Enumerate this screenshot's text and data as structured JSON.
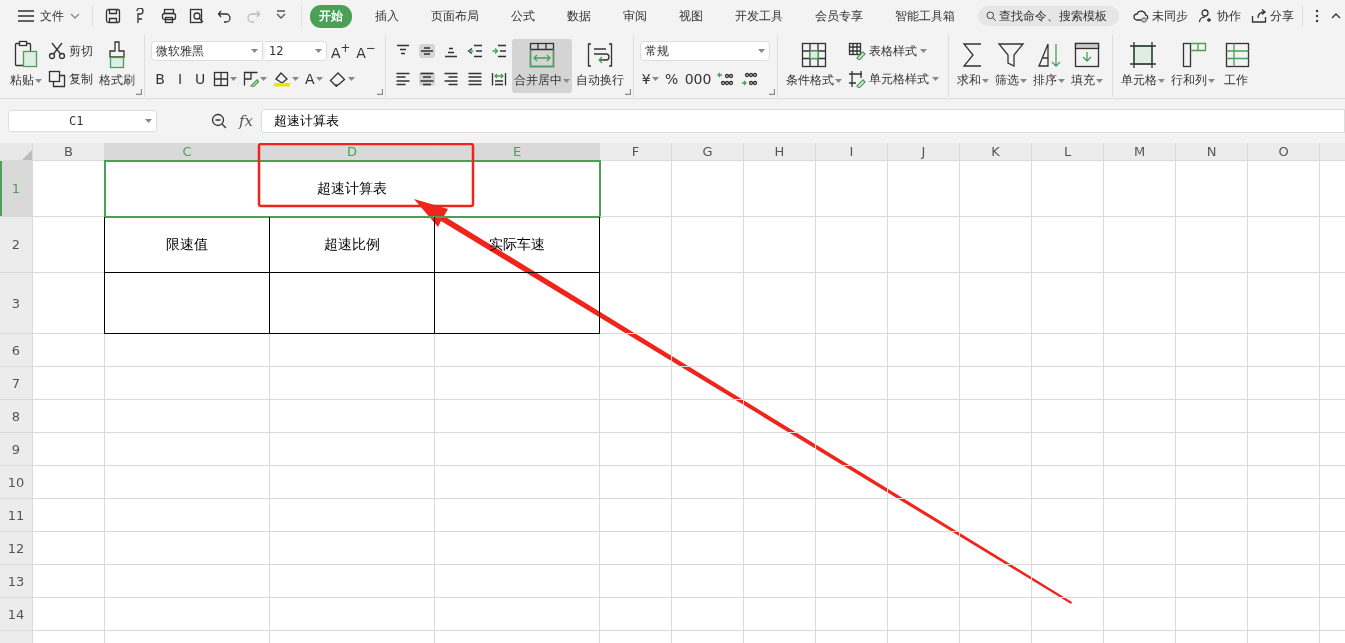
{
  "menu": {
    "file": "文件",
    "tabs": [
      {
        "label": "开始",
        "selected": true
      },
      {
        "label": "插入",
        "selected": false
      },
      {
        "label": "页面布局",
        "selected": false
      },
      {
        "label": "公式",
        "selected": false
      },
      {
        "label": "数据",
        "selected": false
      },
      {
        "label": "审阅",
        "selected": false
      },
      {
        "label": "视图",
        "selected": false
      },
      {
        "label": "开发工具",
        "selected": false
      },
      {
        "label": "会员专享",
        "selected": false
      },
      {
        "label": "智能工具箱",
        "selected": false
      }
    ],
    "search": {
      "placeholder": "查找命令、搜索模板"
    },
    "actions": [
      "未同步",
      "协作",
      "分享"
    ]
  },
  "ribbon": [
    {
      "launcher": true,
      "items": [
        {
          "kind": "big",
          "label": "粘贴",
          "dropdown": true,
          "selected": false
        },
        {
          "kind": "stack",
          "lines": [
            {
              "items": [
                {
                  "kind": "small",
                  "label": "剪切",
                  "dropdown": false
                }
              ]
            },
            {
              "items": [
                {
                  "kind": "small",
                  "label": "复制",
                  "dropdown": false
                }
              ]
            }
          ]
        },
        {
          "kind": "big",
          "label": "格式刷",
          "dropdown": false,
          "selected": false
        }
      ]
    },
    {
      "launcher": true,
      "items": [
        {
          "kind": "stack",
          "lines": [
            {
              "items": [
                {
                  "kind": "font-select",
                  "value": "微软雅黑"
                },
                {
                  "kind": "size-select",
                  "value": "12"
                },
                {
                  "kind": "text",
                  "text": "A$^{+}$",
                  "dropdown": false,
                  "selected": false
                },
                {
                  "kind": "text",
                  "text": "A$^{−}$",
                  "dropdown": false,
                  "selected": false
                }
              ]
            },
            {
              "items": [
                {
                  "kind": "text",
                  "text": "B",
                  "dropdown": false,
                  "selected": false
                },
                {
                  "kind": "text",
                  "text": "I",
                  "dropdown": false,
                  "selected": false
                },
                {
                  "kind": "text",
                  "text": "U",
                  "dropdown": false,
                  "selected": false
                },
                {
                  "kind": "icon",
                  "dropdown": true,
                  "selected": false
                },
                {
                  "kind": "icon",
                  "dropdown": true,
                  "selected": false
                },
                {
                  "kind": "icon",
                  "dropdown": true,
                  "selected": false
                },
                {
                  "kind": "text",
                  "text": "A",
                  "dropdown": true,
                  "selected": false
                },
                {
                  "kind": "icon",
                  "dropdown": true,
                  "selected": false
                }
              ]
            }
          ]
        }
      ]
    },
    {
      "launcher": true,
      "items": [
        {
          "kind": "stack",
          "lines": [
            {
              "items": [
                {
                  "kind": "icon",
                  "dropdown": false,
                  "selected": false
                },
                {
                  "kind": "icon",
                  "dropdown": false,
                  "selected": true
                },
                {
                  "kind": "icon",
                  "dropdown": false,
                  "selected": false
                },
                {
                  "kind": "icon",
                  "dropdown": false,
                  "selected": false
                },
                {
                  "kind": "icon",
                  "dropdown": false,
                  "selected": false
                }
              ]
            },
            {
              "items": [
                {
                  "kind": "icon",
                  "dropdown": false,
                  "selected": false
                },
                {
                  "kind": "icon",
                  "dropdown": false,
                  "selected": true
                },
                {
                  "kind": "icon",
                  "dropdown": false,
                  "selected": false
                },
                {
                  "kind": "icon",
                  "dropdown": false,
                  "selected": false
                },
                {
                  "kind": "icon",
                  "dropdown": false,
                  "selected": false
                }
              ]
            }
          ]
        },
        {
          "kind": "big",
          "label": "合并居中",
          "dropdown": true,
          "selected": true
        },
        {
          "kind": "big",
          "label": "自动换行",
          "dropdown": false,
          "selected": false
        }
      ]
    },
    {
      "launcher": true,
      "items": [
        {
          "kind": "stack",
          "lines": [
            {
              "items": [
                {
                  "kind": "format-select",
                  "value": "常规"
                }
              ]
            },
            {
              "items": [
                {
                  "kind": "text",
                  "text": "¥",
                  "dropdown": true,
                  "selected": false
                },
                {
                  "kind": "text",
                  "text": "%",
                  "dropdown": false,
                  "selected": false
                },
                {
                  "kind": "text",
                  "text": "000",
                  "dropdown": false,
                  "selected": false
                },
                {
                  "kind": "icon",
                  "dropdown": false,
                  "selected": false
                },
                {
                  "kind": "icon",
                  "dropdown": false,
                  "selected": false
                }
              ]
            }
          ]
        }
      ]
    },
    {
      "launcher": false,
      "items": [
        {
          "kind": "big",
          "label": "条件格式",
          "dropdown": true,
          "selected": false
        },
        {
          "kind": "stack",
          "lines": [
            {
              "items": [
                {
                  "kind": "small",
                  "label": "表格样式",
                  "dropdown": true
                }
              ]
            },
            {
              "items": [
                {
                  "kind": "small",
                  "label": "单元格样式",
                  "dropdown": true
                }
              ]
            }
          ]
        }
      ]
    },
    {
      "launcher": false,
      "items": [
        {
          "kind": "big",
          "label": "求和",
          "dropdown": true,
          "selected": false
        },
        {
          "kind": "big",
          "label": "筛选",
          "dropdown": true,
          "selected": false
        },
        {
          "kind": "big",
          "label": "排序",
          "dropdown": true,
          "selected": false
        },
        {
          "kind": "big",
          "label": "填充",
          "dropdown": true,
          "selected": false
        }
      ]
    },
    {
      "launcher": false,
      "items": [
        {
          "kind": "big",
          "label": "单元格",
          "dropdown": true,
          "selected": false
        },
        {
          "kind": "big",
          "label": "行和列",
          "dropdown": true,
          "selected": false
        },
        {
          "kind": "big",
          "label": "工作",
          "dropdown": false,
          "selected": false
        }
      ]
    }
  ],
  "formula_bar": {
    "cell_ref": "C1",
    "fx": "fx",
    "value": "超速计算表"
  },
  "sheet": {
    "columns": [
      {
        "label": "B",
        "selected": false
      },
      {
        "label": "C",
        "selected": true
      },
      {
        "label": "D",
        "selected": true
      },
      {
        "label": "E",
        "selected": true
      },
      {
        "label": "F",
        "selected": false
      },
      {
        "label": "G",
        "selected": false
      },
      {
        "label": "H",
        "selected": false
      },
      {
        "label": "I",
        "selected": false
      },
      {
        "label": "J",
        "selected": false
      },
      {
        "label": "K",
        "selected": false
      },
      {
        "label": "L",
        "selected": false
      },
      {
        "label": "M",
        "selected": false
      },
      {
        "label": "N",
        "selected": false
      },
      {
        "label": "O",
        "selected": false
      }
    ],
    "rows": [
      {
        "label": "1",
        "selected": true
      },
      {
        "label": "2",
        "selected": false
      },
      {
        "label": "3",
        "selected": false
      },
      {
        "label": "6",
        "selected": false
      },
      {
        "label": "7",
        "selected": false
      },
      {
        "label": "8",
        "selected": false
      },
      {
        "label": "9",
        "selected": false
      },
      {
        "label": "10",
        "selected": false
      },
      {
        "label": "11",
        "selected": false
      },
      {
        "label": "12",
        "selected": false
      },
      {
        "label": "13",
        "selected": false
      },
      {
        "label": "14",
        "selected": false
      }
    ],
    "title": {
      "text": "超速计算表",
      "selected": true
    },
    "headers": [
      "限速值",
      "超速比例",
      "实际车速"
    ]
  }
}
